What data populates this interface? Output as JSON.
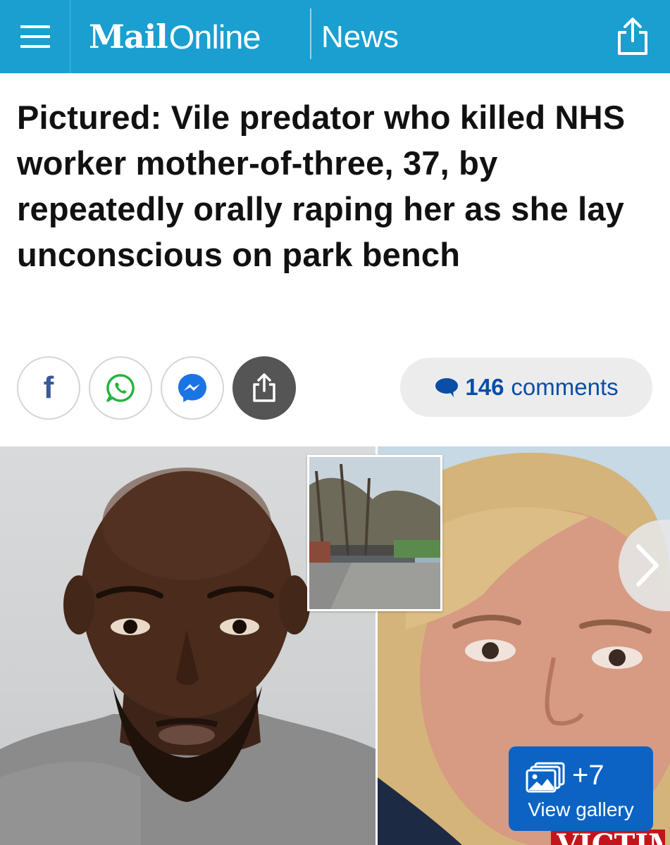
{
  "header": {
    "brand_mail": "Mail",
    "brand_online": "Online",
    "section": "News",
    "menu_icon": "hamburger-menu-icon",
    "share_icon": "share-icon"
  },
  "article": {
    "headline": "Pictured: Vile predator who killed NHS worker mother-of-three, 37, by repeatedly orally raping her as she lay unconscious on park bench"
  },
  "social": {
    "facebook_letter": "f",
    "buttons": [
      "facebook-icon",
      "whatsapp-icon",
      "messenger-icon",
      "share-icon"
    ]
  },
  "comments": {
    "count": "146",
    "label": "comments"
  },
  "gallery": {
    "count": "+7",
    "label": "View gallery"
  },
  "media": {
    "victim_caption": "VICTIM"
  },
  "colors": {
    "header_bg": "#1a9fd0",
    "comments_text": "#0a4ea5",
    "gallery_bg": "#0c63c4",
    "facebook": "#3b5998",
    "whatsapp": "#25b43e",
    "messenger": "#1b74e4"
  }
}
